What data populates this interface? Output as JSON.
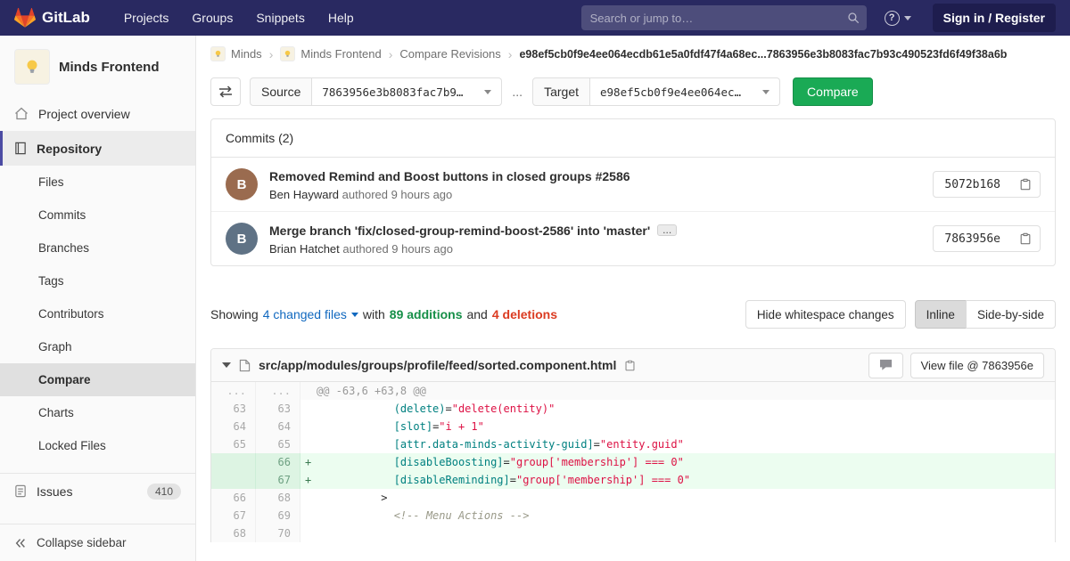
{
  "navbar": {
    "brand": "GitLab",
    "links": [
      "Projects",
      "Groups",
      "Snippets",
      "Help"
    ],
    "search_placeholder": "Search or jump to…",
    "help_label": "?",
    "signin_label": "Sign in / Register"
  },
  "sidebar": {
    "project_name": "Minds Frontend",
    "overview_label": "Project overview",
    "section_label": "Repository",
    "repo_items": [
      {
        "label": "Files",
        "active": false
      },
      {
        "label": "Commits",
        "active": false
      },
      {
        "label": "Branches",
        "active": false
      },
      {
        "label": "Tags",
        "active": false
      },
      {
        "label": "Contributors",
        "active": false
      },
      {
        "label": "Graph",
        "active": false
      },
      {
        "label": "Compare",
        "active": true
      },
      {
        "label": "Charts",
        "active": false
      },
      {
        "label": "Locked Files",
        "active": false
      }
    ],
    "issues_label": "Issues",
    "issues_count": "410",
    "collapse_label": "Collapse sidebar"
  },
  "breadcrumb": {
    "items": [
      "Minds",
      "Minds Frontend",
      "Compare Revisions"
    ],
    "separator": "›",
    "current": "e98ef5cb0f9e4ee064ecdb61e5a0fdf47f4a68ec...7863956e3b8083fac7b93c490523fd6f49f38a6b"
  },
  "compare_form": {
    "source_label": "Source",
    "source_value": "7863956e3b8083fac7b9…",
    "separator": "...",
    "target_label": "Target",
    "target_value": "e98ef5cb0f9e4ee064ec…",
    "compare_button": "Compare"
  },
  "commits": {
    "header": "Commits (2)",
    "expander_label": "...",
    "items": [
      {
        "title": "Removed Remind and Boost buttons in closed groups #2586",
        "author": "Ben Hayward",
        "meta": "authored 9 hours ago",
        "sha": "5072b168",
        "initial": "B",
        "avatar_color": "#9a6b4f",
        "has_expander": false
      },
      {
        "title": "Merge branch 'fix/closed-group-remind-boost-2586' into 'master'",
        "author": "Brian Hatchet",
        "meta": "authored 9 hours ago",
        "sha": "7863956e",
        "initial": "B",
        "avatar_color": "#5f7285",
        "has_expander": true
      }
    ]
  },
  "summary": {
    "showing": "Showing",
    "files_link": "4 changed files",
    "with_text": "with",
    "additions": "89 additions",
    "and_text": "and",
    "deletions": "4 deletions",
    "whitespace_button": "Hide whitespace changes",
    "inline_button": "Inline",
    "side_by_side_button": "Side-by-side"
  },
  "diff": {
    "file_path": "src/app/modules/groups/profile/feed/sorted.component.html",
    "view_file_button": "View file @ 7863956e",
    "rows": [
      {
        "type": "hunk",
        "old": "...",
        "new": "...",
        "sign": "",
        "segments": [
          {
            "t": "@@ -63,6 +63,8 @@",
            "c": "hunk"
          }
        ]
      },
      {
        "type": "ctx",
        "old": "63",
        "new": "63",
        "sign": "",
        "segments": [
          {
            "t": "            ",
            "c": "pl"
          },
          {
            "t": "(delete)",
            "c": "attr"
          },
          {
            "t": "=",
            "c": "pl"
          },
          {
            "t": "\"delete(entity)\"",
            "c": "str"
          }
        ]
      },
      {
        "type": "ctx",
        "old": "64",
        "new": "64",
        "sign": "",
        "segments": [
          {
            "t": "            ",
            "c": "pl"
          },
          {
            "t": "[slot]",
            "c": "attr"
          },
          {
            "t": "=",
            "c": "pl"
          },
          {
            "t": "\"i + 1\"",
            "c": "str"
          }
        ]
      },
      {
        "type": "ctx",
        "old": "65",
        "new": "65",
        "sign": "",
        "segments": [
          {
            "t": "            ",
            "c": "pl"
          },
          {
            "t": "[attr.data-minds-activity-guid]",
            "c": "attr"
          },
          {
            "t": "=",
            "c": "pl"
          },
          {
            "t": "\"entity.guid\"",
            "c": "str"
          }
        ]
      },
      {
        "type": "add",
        "old": "",
        "new": "66",
        "sign": "+",
        "segments": [
          {
            "t": "            ",
            "c": "pl"
          },
          {
            "t": "[disableBoosting]",
            "c": "attr"
          },
          {
            "t": "=",
            "c": "pl"
          },
          {
            "t": "\"group['membership'] === 0\"",
            "c": "str"
          }
        ]
      },
      {
        "type": "add",
        "old": "",
        "new": "67",
        "sign": "+",
        "segments": [
          {
            "t": "            ",
            "c": "pl"
          },
          {
            "t": "[disableReminding]",
            "c": "attr"
          },
          {
            "t": "=",
            "c": "pl"
          },
          {
            "t": "\"group['membership'] === 0\"",
            "c": "str"
          }
        ]
      },
      {
        "type": "ctx",
        "old": "66",
        "new": "68",
        "sign": "",
        "segments": [
          {
            "t": "          >",
            "c": "pl"
          }
        ]
      },
      {
        "type": "ctx",
        "old": "67",
        "new": "69",
        "sign": "",
        "segments": [
          {
            "t": "            ",
            "c": "pl"
          },
          {
            "t": "<!-- Menu Actions -->",
            "c": "cmt"
          }
        ]
      },
      {
        "type": "ctx",
        "old": "68",
        "new": "70",
        "sign": "",
        "segments": []
      }
    ]
  },
  "colors": {
    "navbar_bg": "#292961",
    "accent_indigo": "#4b4ba3",
    "compare_button_green": "#1aaa55",
    "additions_green": "#168f48",
    "deletions_red": "#db3b21",
    "link_blue": "#1068bf",
    "diff_add_line_bg": "#ecfdf0",
    "diff_add_linenum_bg": "#ddf4e3",
    "syntax_attribute": "#008080",
    "syntax_string": "#d14",
    "syntax_comment": "#998"
  }
}
